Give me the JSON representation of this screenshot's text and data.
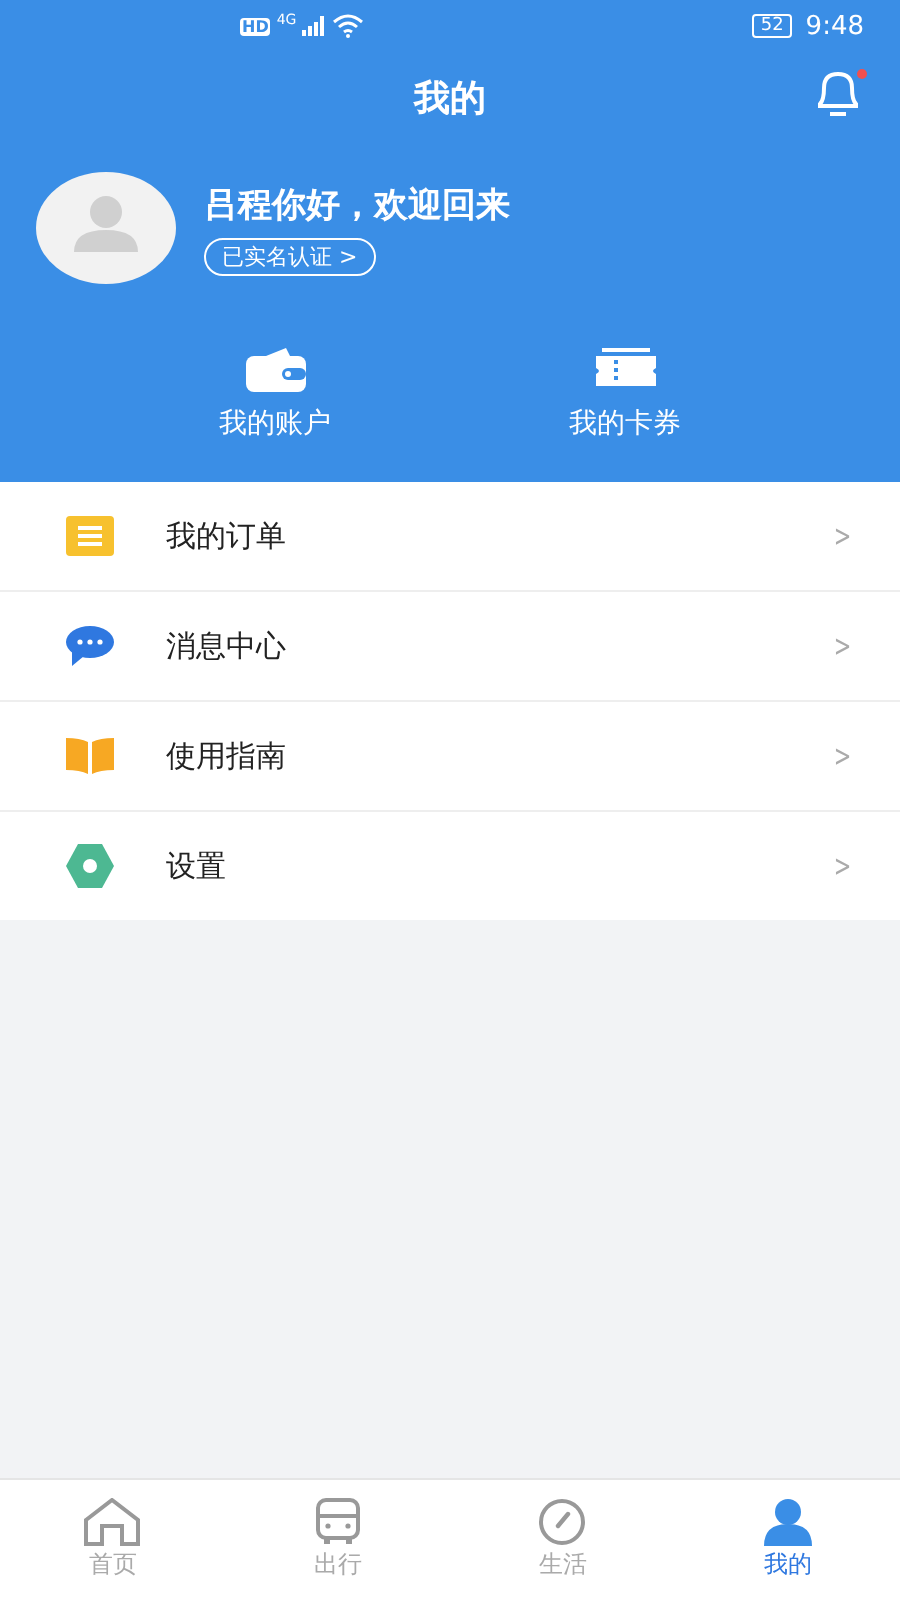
{
  "status_bar": {
    "hd": "HD",
    "network": "4G",
    "battery": "52",
    "time": "9:48"
  },
  "header": {
    "title": "我的",
    "notification_dot": true
  },
  "profile": {
    "greeting": "吕程你好，欢迎回来",
    "verified": "已实名认证 >"
  },
  "shortcuts": [
    {
      "kind": "wallet",
      "label": "我的账户"
    },
    {
      "kind": "ticket",
      "label": "我的卡券"
    }
  ],
  "menu": [
    {
      "kind": "orders",
      "label": "我的订单",
      "chevron": ">"
    },
    {
      "kind": "messages",
      "label": "消息中心",
      "chevron": ">"
    },
    {
      "kind": "guide",
      "label": "使用指南",
      "chevron": ">"
    },
    {
      "kind": "settings",
      "label": "设置",
      "chevron": ">"
    }
  ],
  "tabs": [
    {
      "kind": "home",
      "label": "首页",
      "selected": false
    },
    {
      "kind": "travel",
      "label": "出行",
      "selected": false
    },
    {
      "kind": "life",
      "label": "生活",
      "selected": false
    },
    {
      "kind": "me",
      "label": "我的",
      "selected": true
    }
  ]
}
